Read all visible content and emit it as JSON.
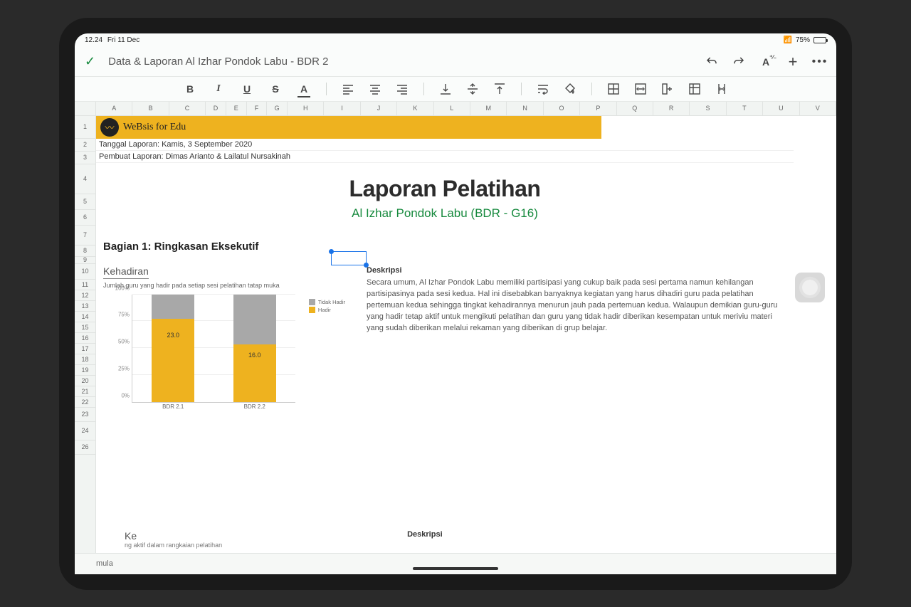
{
  "status": {
    "time": "12.24",
    "date": "Fri 11 Dec",
    "battery_pct": "75%"
  },
  "doc_title": "Data & Laporan Al Izhar Pondok Labu - BDR 2",
  "columns": [
    "A",
    "B",
    "C",
    "D",
    "E",
    "F",
    "G",
    "H",
    "I",
    "J",
    "K",
    "L",
    "M",
    "N",
    "O",
    "P",
    "Q",
    "R",
    "S",
    "T",
    "U",
    "V"
  ],
  "rows": [
    "1",
    "2",
    "3",
    "4",
    "5",
    "6",
    "7",
    "8",
    "9",
    "10",
    "11",
    "12",
    "13",
    "14",
    "15",
    "16",
    "17",
    "18",
    "19",
    "20",
    "21",
    "22",
    "23",
    "24",
    "26"
  ],
  "brand": "WeBsis for Edu",
  "meta1": "Tanggal Laporan: Kamis, 3 September 2020",
  "meta2": "Pembuat Laporan: Dimas Arianto & Lailatul Nursakinah",
  "title": "Laporan Pelatihan",
  "subtitle": "Al Izhar Pondok Labu (BDR - G16)",
  "section1": "Bagian 1: Ringkasan Eksekutif",
  "kehadiran_h": "Kehadiran",
  "kehadiran_sub": "Jumlah guru yang hadir pada setiap sesi pelatihan tatap muka",
  "deskripsi_h": "Deskripsi",
  "deskripsi_body": "Secara umum, Al Izhar Pondok Labu memiliki partisipasi yang cukup baik pada sesi pertama namun kehilangan partisipasinya pada sesi kedua. Hal ini disebabkan banyaknya kegiatan yang harus dihadiri guru pada pelatihan pertemuan kedua sehingga tingkat kehadirannya menurun jauh pada pertemuan kedua. Walaupun demikian guru-guru yang hadir tetap aktif untuk mengikuti pelatihan dan guru yang tidak hadir diberikan kesempatan untuk meriviu materi yang sudah diberikan melalui rekaman yang diberikan di grup belajar.",
  "partial_keaktifan": "Ke",
  "partial_keaktifan_sub": "ng aktif dalam rangkaian pelatihan",
  "partial_desk2": "Deskripsi",
  "tabs": {
    "formula": "mula"
  },
  "chart_data": {
    "type": "bar",
    "stacked": true,
    "categories": [
      "BDR 2.1",
      "BDR 2.2"
    ],
    "series": [
      {
        "name": "Hadir",
        "color": "#eeb21f",
        "values": [
          23.0,
          16.0
        ]
      },
      {
        "name": "Tidak Hadir",
        "color": "#a8a8a8",
        "values": [
          7.0,
          14.0
        ]
      }
    ],
    "data_labels": [
      "23.0",
      "16.0"
    ],
    "ylim": [
      0,
      30
    ],
    "yticks": [
      "0%",
      "25%",
      "50%",
      "75%",
      "100%"
    ],
    "legend": [
      "Tidak Hadir",
      "Hadir"
    ]
  }
}
